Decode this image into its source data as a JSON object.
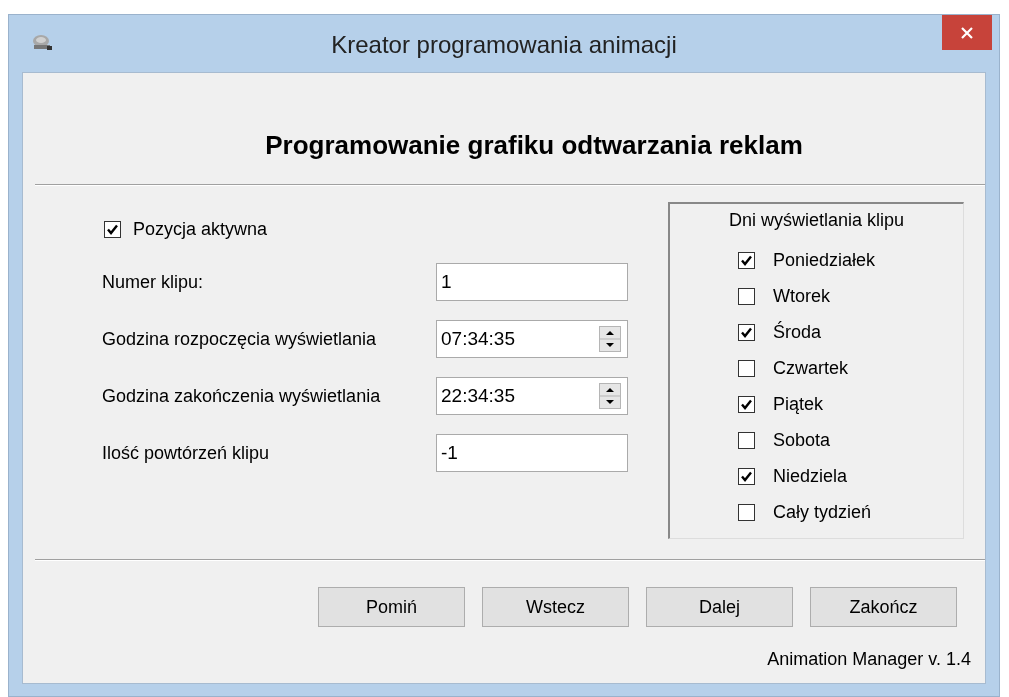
{
  "window": {
    "title": "Kreator programowania animacji"
  },
  "heading": "Programowanie grafiku odtwarzania reklam",
  "active_checkbox": {
    "label": "Pozycja aktywna",
    "checked": true
  },
  "fields": [
    {
      "kind": "text",
      "label": "Numer klipu:",
      "value": "1"
    },
    {
      "kind": "spinner",
      "label": "Godzina rozpoczęcia wyświetlania",
      "value": "07:34:35"
    },
    {
      "kind": "spinner",
      "label": "Godzina zakończenia wyświetlania",
      "value": "22:34:35"
    },
    {
      "kind": "text",
      "label": "Ilość powtórzeń klipu",
      "value": "-1"
    }
  ],
  "days_group": {
    "title": "Dni wyświetlania klipu",
    "days": [
      {
        "label": "Poniedziałek",
        "checked": true
      },
      {
        "label": "Wtorek",
        "checked": false
      },
      {
        "label": "Środa",
        "checked": true
      },
      {
        "label": "Czwartek",
        "checked": false
      },
      {
        "label": "Piątek",
        "checked": true
      },
      {
        "label": "Sobota",
        "checked": false
      },
      {
        "label": "Niedziela",
        "checked": true
      },
      {
        "label": "Cały tydzień",
        "checked": false
      }
    ]
  },
  "buttons": [
    "Pomiń",
    "Wstecz",
    "Dalej",
    "Zakończ"
  ],
  "footer": "Animation Manager v. 1.4"
}
